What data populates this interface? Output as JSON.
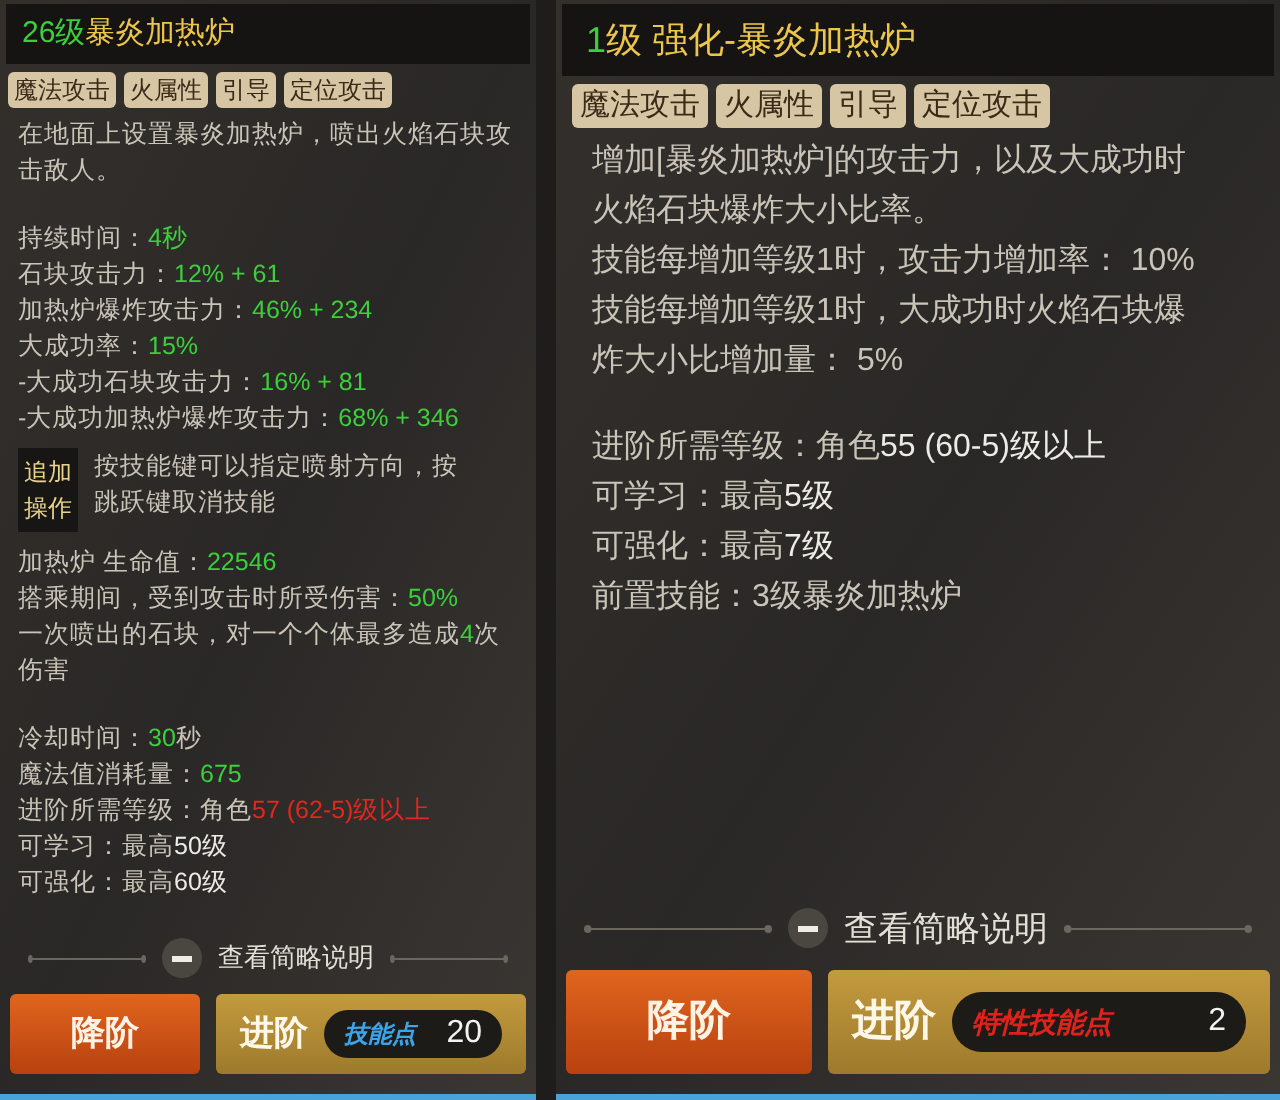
{
  "panels": [
    {
      "title": [
        {
          "text": "26级",
          "kind": "value"
        },
        {
          "text": " 暴炎加热炉",
          "kind": "name"
        }
      ],
      "tags": [
        "魔法攻击",
        "火属性",
        "引导",
        "定位攻击"
      ],
      "blocks": [
        {
          "kind": "paragraph",
          "segments": [
            {
              "text": "在地面上设置暴炎加热炉，喷出火焰石块攻击敌人。",
              "kind": "plain"
            }
          ]
        },
        {
          "kind": "blank"
        },
        {
          "kind": "paragraph",
          "segments": [
            {
              "text": "持续时间：",
              "kind": "plain"
            },
            {
              "text": "4秒",
              "kind": "value"
            }
          ]
        },
        {
          "kind": "paragraph",
          "segments": [
            {
              "text": "石块攻击力：",
              "kind": "plain"
            },
            {
              "text": "12% + 61",
              "kind": "value"
            }
          ]
        },
        {
          "kind": "paragraph",
          "segments": [
            {
              "text": "加热炉爆炸攻击力：",
              "kind": "plain"
            },
            {
              "text": "46% + 234",
              "kind": "value"
            }
          ]
        },
        {
          "kind": "paragraph",
          "segments": [
            {
              "text": "大成功率：",
              "kind": "plain"
            },
            {
              "text": "15%",
              "kind": "value"
            }
          ]
        },
        {
          "kind": "paragraph",
          "segments": [
            {
              "text": "-大成功石块攻击力：",
              "kind": "plain"
            },
            {
              "text": "16% + 81",
              "kind": "value"
            }
          ]
        },
        {
          "kind": "paragraph",
          "segments": [
            {
              "text": "-大成功加热炉爆炸攻击力：",
              "kind": "plain"
            },
            {
              "text": "68% + 346",
              "kind": "value"
            }
          ]
        },
        {
          "kind": "extra",
          "label": "追加操作",
          "text": "按技能键可以指定喷射方向，按跳跃键取消技能"
        },
        {
          "kind": "paragraph",
          "segments": [
            {
              "text": "加热炉 生命值：",
              "kind": "plain"
            },
            {
              "text": "22546",
              "kind": "value"
            }
          ]
        },
        {
          "kind": "paragraph",
          "segments": [
            {
              "text": "搭乘期间，受到攻击时所受伤害：",
              "kind": "plain"
            },
            {
              "text": "50%",
              "kind": "value"
            }
          ]
        },
        {
          "kind": "paragraph",
          "segments": [
            {
              "text": "一次喷出的石块，对一个个体最多造成",
              "kind": "plain"
            },
            {
              "text": "4",
              "kind": "value"
            },
            {
              "text": "次伤害",
              "kind": "plain"
            }
          ]
        },
        {
          "kind": "blank"
        },
        {
          "kind": "paragraph",
          "segments": [
            {
              "text": "冷却时间：",
              "kind": "plain"
            },
            {
              "text": "30",
              "kind": "value"
            },
            {
              "text": "秒",
              "kind": "plain"
            }
          ]
        },
        {
          "kind": "paragraph",
          "segments": [
            {
              "text": "魔法值消耗量：",
              "kind": "plain"
            },
            {
              "text": "675",
              "kind": "value"
            }
          ]
        },
        {
          "kind": "paragraph",
          "segments": [
            {
              "text": "进阶所需等级：角色",
              "kind": "plain"
            },
            {
              "text": "57 (62-5)级以上",
              "kind": "warning"
            }
          ]
        },
        {
          "kind": "paragraph",
          "segments": [
            {
              "text": "可学习：最高",
              "kind": "plain"
            },
            {
              "text": "50级",
              "kind": "bright"
            }
          ]
        },
        {
          "kind": "paragraph",
          "segments": [
            {
              "text": "可强化：最高",
              "kind": "plain"
            },
            {
              "text": "60级",
              "kind": "bright"
            }
          ]
        }
      ],
      "toggle": {
        "label": "查看简略说明",
        "expanded": true
      },
      "buttons": [
        {
          "kind": "downgrade",
          "label": "降阶"
        },
        {
          "kind": "upgrade",
          "label": "进阶",
          "points": {
            "kind": "skill",
            "label": "技能点",
            "value": "20"
          }
        }
      ]
    },
    {
      "title": [
        {
          "text": "1",
          "kind": "value"
        },
        {
          "text": "级 强化-暴炎加热炉",
          "kind": "name"
        }
      ],
      "tags": [
        "魔法攻击",
        "火属性",
        "引导",
        "定位攻击"
      ],
      "blocks": [
        {
          "kind": "paragraph",
          "segments": [
            {
              "text": "增加[暴炎加热炉]的攻击力，以及大成功时火焰石块爆炸大小比率。",
              "kind": "plain"
            }
          ]
        },
        {
          "kind": "paragraph",
          "segments": [
            {
              "text": "技能每增加等级1时，攻击力增加率： 10%",
              "kind": "plain"
            }
          ]
        },
        {
          "kind": "paragraph",
          "segments": [
            {
              "text": "技能每增加等级1时，大成功时火焰石块爆炸大小比增加量： 5%",
              "kind": "plain"
            }
          ]
        },
        {
          "kind": "blank"
        },
        {
          "kind": "paragraph",
          "segments": [
            {
              "text": "进阶所需等级：角色",
              "kind": "plain"
            },
            {
              "text": "55 (60-5)级以上",
              "kind": "bright"
            }
          ]
        },
        {
          "kind": "paragraph",
          "segments": [
            {
              "text": "可学习：最高",
              "kind": "plain"
            },
            {
              "text": "5级",
              "kind": "bright"
            }
          ]
        },
        {
          "kind": "paragraph",
          "segments": [
            {
              "text": "可强化：最高",
              "kind": "plain"
            },
            {
              "text": "7级",
              "kind": "bright"
            }
          ]
        },
        {
          "kind": "paragraph",
          "segments": [
            {
              "text": "前置技能：3级暴炎加热炉",
              "kind": "plain"
            }
          ]
        }
      ],
      "toggle": {
        "label": "查看简略说明",
        "expanded": true
      },
      "buttons": [
        {
          "kind": "downgrade",
          "label": "降阶"
        },
        {
          "kind": "upgrade",
          "label": "进阶",
          "points": {
            "kind": "trait",
            "label": "特性技能点",
            "value": "2"
          }
        }
      ]
    }
  ]
}
